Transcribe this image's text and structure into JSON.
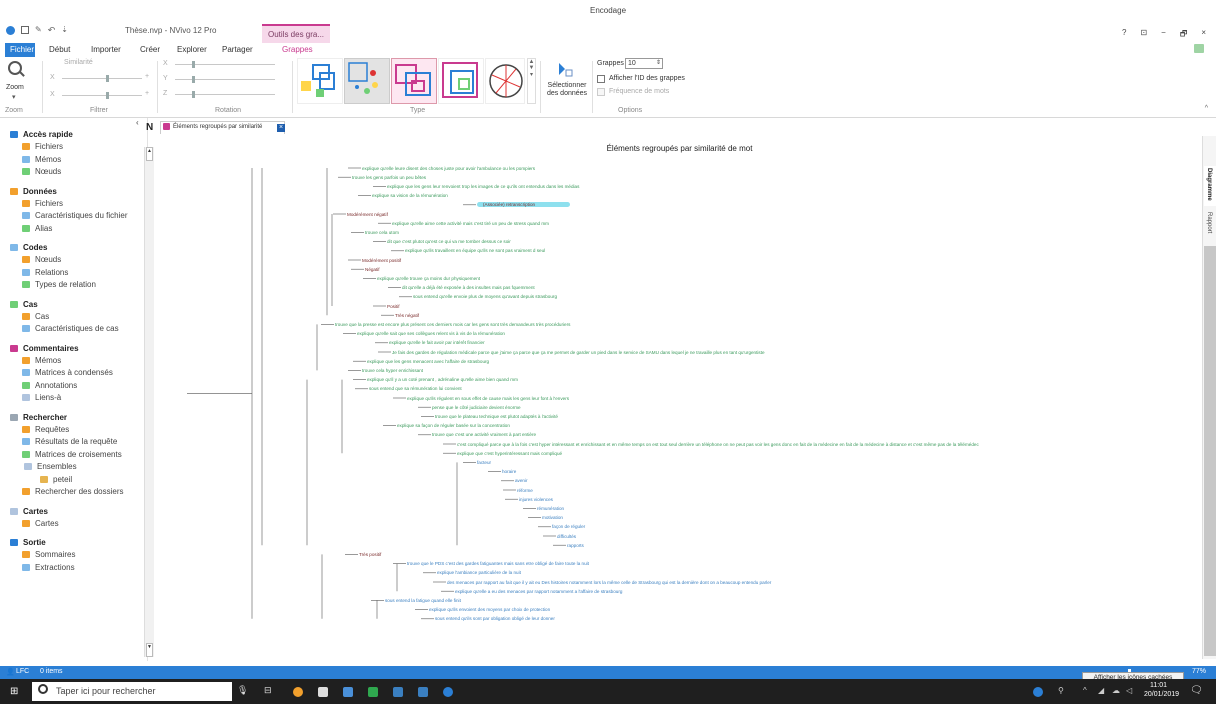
{
  "window": {
    "title": "Encodage",
    "file_title": "Thèse.nvp - NVivo 12 Pro",
    "contextual_tab": "Outils des gra...",
    "controls": [
      "?",
      "⊡",
      "−",
      "🗗",
      "×"
    ]
  },
  "menu": {
    "items": [
      "Fichier",
      "Début",
      "Importer",
      "Créer",
      "Explorer",
      "Partager",
      "Grappes"
    ]
  },
  "ribbon": {
    "zoom_label": "Zoom",
    "zoom_group": "Zoom",
    "similarity_label": "Similarité",
    "filter_group": "Filtrer",
    "rotation_group": "Rotation",
    "type_group": "Type",
    "axis_x": "X",
    "axis_y": "Y",
    "axis_z": "Z",
    "select_data": "Sélectionner des données",
    "clusters_label": "Grappes",
    "clusters_value": "10",
    "show_id": "Afficher l'ID des grappes",
    "word_freq": "Fréquence de mots",
    "options_group": "Options"
  },
  "nav": {
    "sections": [
      {
        "title": "Accès rapide",
        "items": [
          "Fichiers",
          "Mémos",
          "Nœuds"
        ]
      },
      {
        "title": "Données",
        "items": [
          "Fichiers",
          "Caractéristiques du fichier",
          "Alias"
        ]
      },
      {
        "title": "Codes",
        "items": [
          "Nœuds",
          "Relations",
          "Types de relation"
        ]
      },
      {
        "title": "Cas",
        "items": [
          "Cas",
          "Caractéristiques de cas"
        ]
      },
      {
        "title": "Commentaires",
        "items": [
          "Mémos",
          "Matrices à condensés",
          "Annotations",
          "Liens-à"
        ]
      },
      {
        "title": "Rechercher",
        "items": [
          "Requêtes",
          "Résultats de la requête",
          "Matrices de croisements",
          "Ensembles",
          "peteil",
          "Rechercher des dossiers"
        ]
      },
      {
        "title": "Cartes",
        "items": [
          "Cartes"
        ]
      },
      {
        "title": "Sortie",
        "items": [
          "Sommaires",
          "Extractions"
        ]
      }
    ]
  },
  "tab": {
    "label": "Éléments regroupés par similarité",
    "side_letter": "N"
  },
  "diagram": {
    "title": "Éléments regroupés par similarité de mot",
    "leaves": [
      "explique qu'elle leure disent des choses juste pour avoir l'ambulance ou les pompiers",
      "trouve les gens parfois un peu bêtes",
      "explique que les gens leur renvoient trop les images de ce qu'ils ont entendus dans les médias",
      "explique sa vision de la rémunération",
      "(Associée) retranscription",
      "Modérément négatif",
      "explique qu'elle aime cette activité mais c'est tiré un peu de stress quand mm",
      "trouve cela utom",
      "dit que c'est plutot qu'est ce qui va me tomber dessus ce soir",
      "explique qu'ils travaillent en équipe qu'ils ne sont pas vraiment d seul",
      "Modérément positif",
      "Négatif",
      "explique qu'elle trouve ça moins dur physiquement",
      "dit qu'elle a déjà été exposée à des insultes mais pas fquemment",
      "sous entend qu'elle envoie plus de moyens qu'avant depuis strasbourg",
      "Positif",
      "Très négatif",
      "trouve que la presse est encore plus présent ces derniers mois car les gens sont très demandeurs très procéduriers",
      "explique qu'elle sait que ses collègues relent vis à vis de la rémunération",
      "explique qu'elle le fait avoir par intérêt financier",
      "Je fais des gardes de régulation médicale parce que j'aime ça parce que ça me permet de garder un pied dans le service de SAMU dans lequel je ne travaille plus en tant qu'urgentiste",
      "explique que les gens menacent avec l'affaire de strasbourg",
      "trouve cela hyper enrichissant",
      "explique qu'il y a un coté prenant , adrénaline qu'elle aime bien quand mm",
      "sous entend que sa rémunération lui convient",
      "explique qu'ils régulent en sous effet de cause mais les gens leur font à l'envers",
      "pense que le côté judiciaire devient énorme",
      "trouve que le plateau technique est plutot adaptés à l'activité",
      "explique sa façon de réguler basée sur la concentration",
      "trouve que c'est une activité vraiment à part entière",
      "c'est compliqué parce que à la fois c'est hyper intéressant et enrichissant et en même temps on est tout seul derrière un téléphone on ne peut pas voir les gens donc en fait de la médecine en fait de la médecine à distance et c'est même pas de la télémédec",
      "explique que c'est hyperintéressant mais compliqué",
      "facteur",
      "horaire",
      "avenir",
      "réforme",
      "injures violences",
      "rémunération",
      "motivation",
      "façon de réguler",
      "difficultés",
      "rapports",
      "Très positif",
      "trouve que le PDS c'est des gardes fatiguantes mais sans etre obligé de faire toute la nuit",
      "explique l'ambiance particulière de la nuit",
      "des menaces par rapport au fait que il y ait eu Des histoires notamment lors la même celle de Strasbourg qui est la dernière dont on a beaucoup entendu parler",
      "explique qu'elle a eu des menaces par rapport notamment a l'affaire de strasbourg",
      "sous entend la fatigue quand elle finit",
      "explique qu'ils envoient des moyens par choix de protection",
      "sous entend qu'ils sont par obligation obligé de leur donner"
    ]
  },
  "right_tabs": [
    "Diagramme",
    "Rapport"
  ],
  "status": {
    "user": "LFC",
    "items": "0 items",
    "zoom": "77%",
    "tooltip": "Afficher les icônes cachées"
  },
  "taskbar": {
    "search": "Taper ici pour rechercher",
    "time": "11:01",
    "date": "20/01/2019"
  },
  "colors": {
    "accent": "#2b7fd5",
    "contextual": "#c93a8f",
    "leaf_green": "#3b9a5c",
    "leaf_blue": "#3a7fc0",
    "leaf_dark": "#7a2b2b",
    "highlight": "#8ee0ee"
  }
}
